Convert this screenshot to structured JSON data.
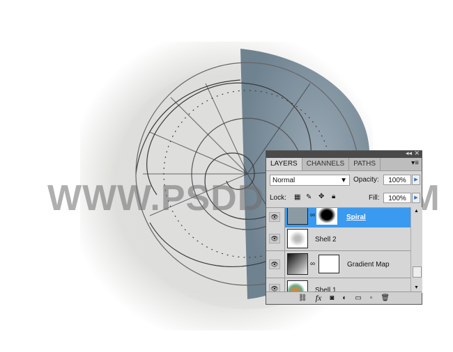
{
  "watermark": "WWW.PSDDUDE.COM",
  "panel": {
    "tabs": [
      {
        "label": "LAYERS",
        "active": true
      },
      {
        "label": "CHANNELS",
        "active": false
      },
      {
        "label": "PATHS",
        "active": false
      }
    ],
    "blend_mode": "Normal",
    "opacity_label": "Opacity:",
    "opacity_value": "100%",
    "lock_label": "Lock:",
    "fill_label": "Fill:",
    "fill_value": "100%",
    "layers": [
      {
        "name": "Spiral",
        "selected": true
      },
      {
        "name": "Shell 2",
        "selected": false
      },
      {
        "name": "Gradient Map",
        "selected": false
      },
      {
        "name": "Shell 1",
        "selected": false
      }
    ],
    "bottom_icons": [
      "link-icon",
      "fx-icon",
      "mask-icon",
      "adjustment-icon",
      "folder-icon",
      "new-layer-icon",
      "trash-icon"
    ],
    "fx_label": "fx",
    "accent": "#3a9af0"
  }
}
